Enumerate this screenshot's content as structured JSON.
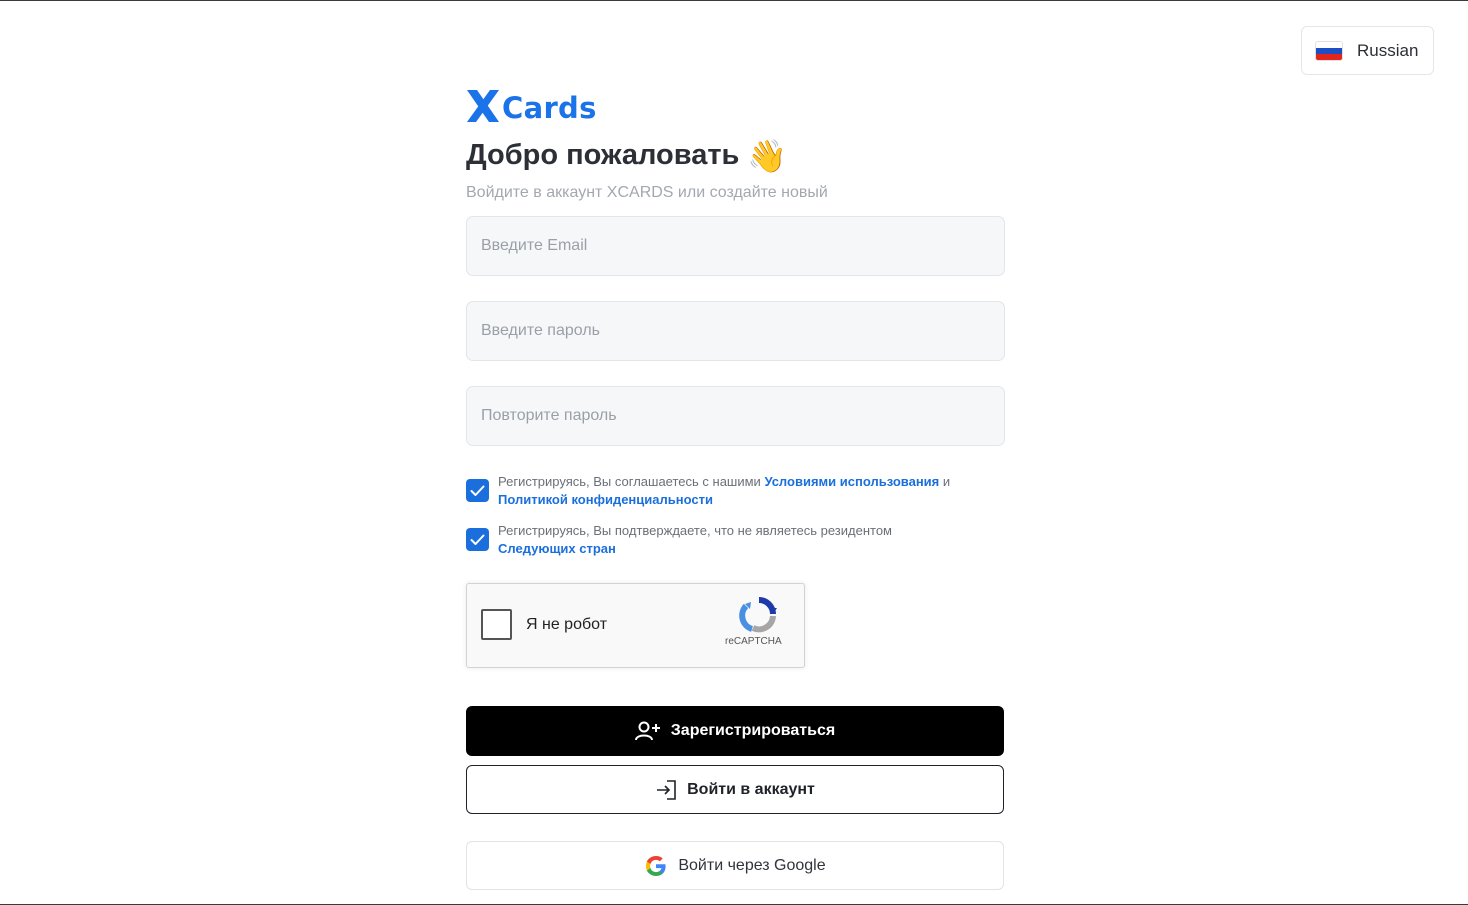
{
  "language": {
    "label": "Russian",
    "flag_icon": "russia-flag-icon"
  },
  "brand": {
    "logo_letter": "X",
    "logo_text": "Cards",
    "color": "#1a73e8"
  },
  "header": {
    "title": "Добро пожаловать",
    "title_emoji": "👋",
    "subtitle": "Войдите в аккаунт XCARDS или создайте новый"
  },
  "form": {
    "email_placeholder": "Введите Email",
    "password_placeholder": "Введите пароль",
    "repeat_password_placeholder": "Повторите пароль"
  },
  "consents": [
    {
      "checked": true,
      "text_before": "Регистрируясь, Вы соглашаетесь с нашими ",
      "link1": "Условиями использования",
      "text_middle": " и ",
      "link2": "Политикой конфиденциальности"
    },
    {
      "checked": true,
      "text_before": "Регистрируясь, Вы подтверждаете, что не являетесь резидентом ",
      "link1": "Следующих стран"
    }
  ],
  "captcha": {
    "label": "Я не робот",
    "brand": "reCAPTCHA"
  },
  "buttons": {
    "register": "Зарегистрироваться",
    "login": "Войти в аккаунт",
    "google": "Войти через Google"
  },
  "colors": {
    "accent": "#1a6fdc",
    "primary_button": "#000000"
  }
}
